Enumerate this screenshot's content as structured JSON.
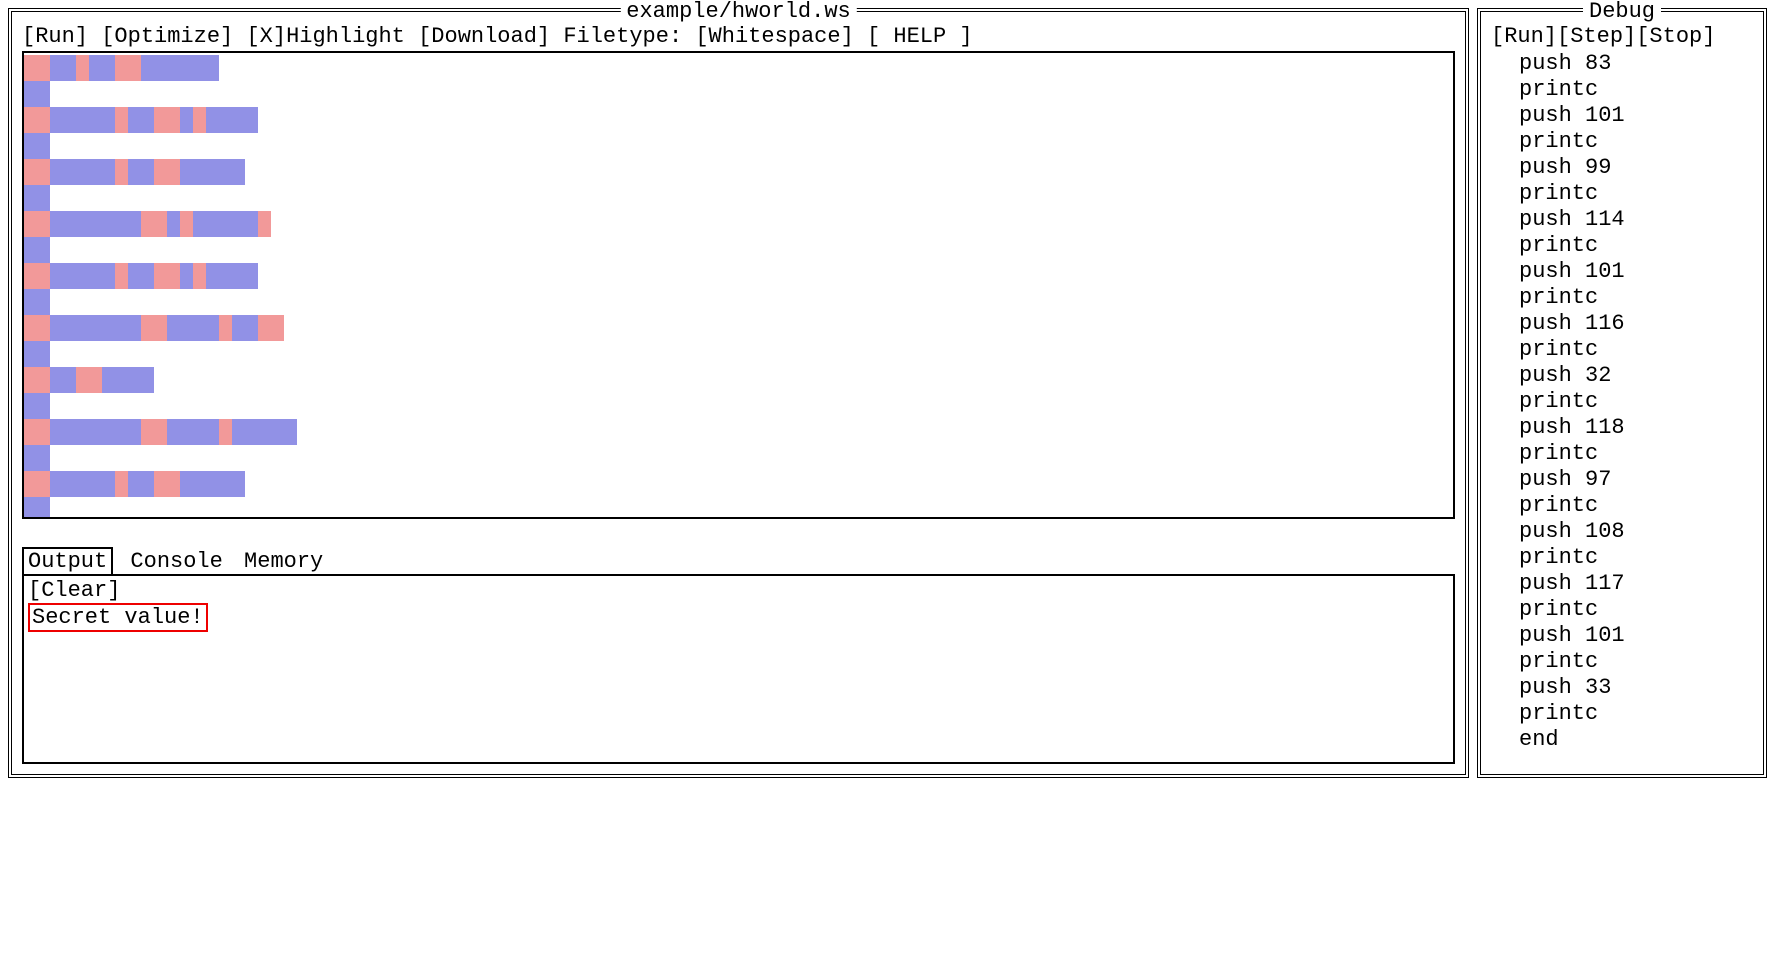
{
  "main": {
    "title": "example/hworld.ws",
    "toolbar": {
      "run": "[Run]",
      "optimize": "[Optimize]",
      "highlight_prefix": "[X]",
      "highlight_label": "Highlight",
      "download": "[Download]",
      "filetype_label": "Filetype:",
      "filetype_value": "[Whitespace]",
      "help": "[ HELP ]"
    },
    "code_lines": [
      [
        [
          "sp",
          2
        ],
        [
          "tb",
          2
        ],
        [
          "sp",
          1
        ],
        [
          "tb",
          2
        ],
        [
          "sp",
          2
        ],
        [
          "tb",
          6
        ]
      ],
      [
        [
          "tb",
          2
        ]
      ],
      [
        [
          "sp",
          2
        ],
        [
          "tb",
          5
        ],
        [
          "sp",
          1
        ],
        [
          "tb",
          2
        ],
        [
          "sp",
          2
        ],
        [
          "tb",
          1
        ],
        [
          "sp",
          1
        ],
        [
          "tb",
          4
        ]
      ],
      [
        [
          "tb",
          2
        ]
      ],
      [
        [
          "sp",
          2
        ],
        [
          "tb",
          5
        ],
        [
          "sp",
          1
        ],
        [
          "tb",
          2
        ],
        [
          "sp",
          2
        ],
        [
          "tb",
          5
        ]
      ],
      [
        [
          "tb",
          2
        ]
      ],
      [
        [
          "sp",
          2
        ],
        [
          "tb",
          7
        ],
        [
          "sp",
          2
        ],
        [
          "tb",
          1
        ],
        [
          "sp",
          1
        ],
        [
          "tb",
          5
        ],
        [
          "sp",
          1
        ]
      ],
      [
        [
          "tb",
          2
        ]
      ],
      [
        [
          "sp",
          2
        ],
        [
          "tb",
          5
        ],
        [
          "sp",
          1
        ],
        [
          "tb",
          2
        ],
        [
          "sp",
          2
        ],
        [
          "tb",
          1
        ],
        [
          "sp",
          1
        ],
        [
          "tb",
          4
        ]
      ],
      [
        [
          "tb",
          2
        ]
      ],
      [
        [
          "sp",
          2
        ],
        [
          "tb",
          7
        ],
        [
          "sp",
          2
        ],
        [
          "tb",
          4
        ],
        [
          "sp",
          1
        ],
        [
          "tb",
          2
        ],
        [
          "sp",
          2
        ]
      ],
      [
        [
          "tb",
          2
        ]
      ],
      [
        [
          "sp",
          2
        ],
        [
          "tb",
          2
        ],
        [
          "sp",
          2
        ],
        [
          "tb",
          4
        ]
      ],
      [
        [
          "tb",
          2
        ]
      ],
      [
        [
          "sp",
          2
        ],
        [
          "tb",
          7
        ],
        [
          "sp",
          2
        ],
        [
          "tb",
          4
        ],
        [
          "sp",
          1
        ],
        [
          "tb",
          5
        ]
      ],
      [
        [
          "tb",
          2
        ]
      ],
      [
        [
          "sp",
          2
        ],
        [
          "tb",
          5
        ],
        [
          "sp",
          1
        ],
        [
          "tb",
          2
        ],
        [
          "sp",
          2
        ],
        [
          "tb",
          5
        ]
      ],
      [
        [
          "tb",
          2
        ]
      ]
    ],
    "tabs": {
      "output": "Output",
      "console": "Console",
      "memory": "Memory",
      "selected": "output"
    },
    "output": {
      "clear": "[Clear]",
      "text": "Secret value!"
    }
  },
  "debug": {
    "title": "Debug",
    "toolbar": {
      "run": "[Run]",
      "step": "[Step]",
      "stop": "[Stop]"
    },
    "ops": [
      "push 83",
      "printc",
      "push 101",
      "printc",
      "push 99",
      "printc",
      "push 114",
      "printc",
      "push 101",
      "printc",
      "push 116",
      "printc",
      "push 32",
      "printc",
      "push 118",
      "printc",
      "push 97",
      "printc",
      "push 108",
      "printc",
      "push 117",
      "printc",
      "push 101",
      "printc",
      "push 33",
      "printc",
      "end"
    ]
  }
}
